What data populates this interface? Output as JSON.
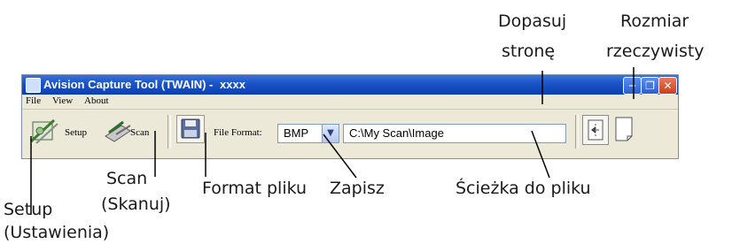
{
  "window": {
    "title": "Avision Capture Tool (TWAIN) -",
    "title_suffix": "xxxx",
    "controls": [
      "minimize",
      "restore",
      "close"
    ]
  },
  "menu": {
    "items": [
      {
        "label": "File"
      },
      {
        "label": "View"
      },
      {
        "label": "About"
      }
    ]
  },
  "toolbar": {
    "setup_label": "Setup",
    "scan_label": "Scan",
    "file_format_label": "File Format:",
    "file_format_value": "BMP",
    "path_value": "C:\\My Scan\\Image"
  },
  "callouts": {
    "fit_line1": "Dopasuj",
    "fit_line2": "stronę",
    "actual_line1": "Rozmiar",
    "actual_line2": "rzeczywisty",
    "scan_line1": "Scan",
    "scan_line2": "(Skanuj)",
    "format": "Format pliku",
    "save": "Zapisz",
    "path": "Ścieżka do pliku",
    "setup_line1": "Setup",
    "setup_line2": "(Ustawienia)"
  },
  "colors": {
    "titlebar": "#1b55c8",
    "window_bg": "#ece9d8",
    "close_button": "#c8401c"
  },
  "icons": [
    "app-icon",
    "setup-icon",
    "scan-icon",
    "save-disk-icon",
    "fit-page-icon",
    "actual-size-icon",
    "chevron-down-icon"
  ]
}
